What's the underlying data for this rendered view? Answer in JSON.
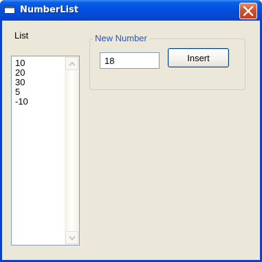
{
  "window": {
    "title": "NumberList",
    "titlebar_color": "#0451dd",
    "close_color": "#c63d1a"
  },
  "list": {
    "label": "List",
    "items": [
      "10",
      "20",
      "30",
      "5",
      "-10"
    ]
  },
  "new_number_group": {
    "legend": "New Number",
    "input_value": "18",
    "insert_label": "Insert"
  },
  "icons": {
    "window": "window-icon",
    "close": "close-x-icon",
    "scroll_up": "chevron-up-icon",
    "scroll_down": "chevron-down-icon"
  },
  "colors": {
    "client_background": "#ebe7d9",
    "group_legend_text": "#2155d1"
  }
}
